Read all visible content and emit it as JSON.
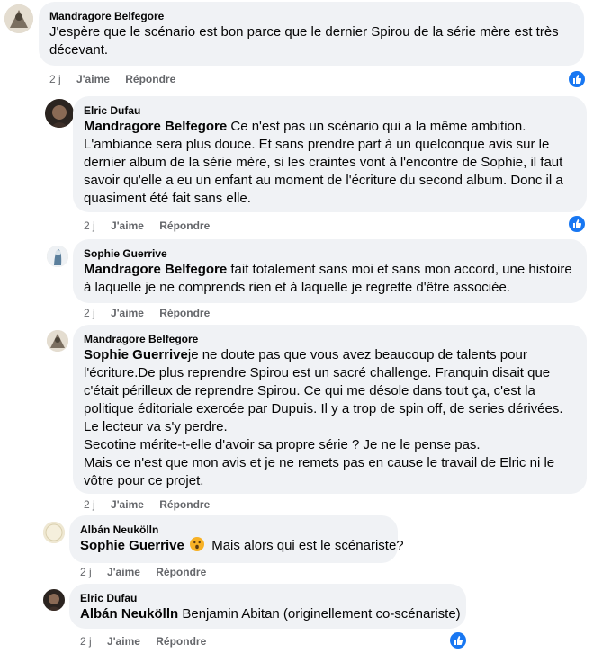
{
  "comments": [
    {
      "author": "Mandragore Belfegore",
      "lines": [
        "J'espère que le scénario est bon parce que le dernier Spirou de la série mère est très",
        "décevant."
      ],
      "time": "2 j",
      "like": "J'aime",
      "reply": "Répondre"
    },
    {
      "author": "Elric Dufau",
      "mention": "Mandragore Belfegore",
      "lines": [
        " Ce n'est pas un scénario qui a la même ambition.",
        "L'ambiance sera plus douce. Et sans prendre part à un quelconque avis sur le",
        "dernier album de la série mère, si les craintes vont à l'encontre de Sophie, il faut",
        "savoir qu'elle a eu un enfant au moment de l'écriture du second album. Donc il a",
        "quasiment été fait sans elle."
      ],
      "time": "2 j",
      "like": "J'aime",
      "reply": "Répondre"
    },
    {
      "author": "Sophie Guerrive",
      "mention": "Mandragore Belfegore",
      "lines": [
        " fait totalement sans moi et sans mon accord, une histoire",
        "à laquelle je ne comprends rien et à laquelle je regrette d'être associée."
      ],
      "time": "2 j",
      "like": "J'aime",
      "reply": "Répondre"
    },
    {
      "author": "Mandragore Belfegore",
      "mention": "Sophie Guerrive",
      "lines": [
        "je ne doute pas que vous avez beaucoup de talents pour",
        "l'écriture.De plus reprendre Spirou est un sacré challenge. Franquin disait que",
        "c'était périlleux de reprendre Spirou. Ce qui me désole dans tout ça, c'est la",
        "politique éditoriale exercée par Dupuis. Il y a trop de spin off, de series dérivées.",
        "Le lecteur va s'y perdre.",
        "Secotine mérite-t-elle d'avoir sa propre série ? Je ne le pense pas.",
        "Mais ce n'est que mon avis et je ne remets pas en cause le travail de Elric ni le",
        "vôtre pour ce projet."
      ],
      "time": "2 j",
      "like": "J'aime",
      "reply": "Répondre"
    },
    {
      "author": "Albán Neukölln",
      "mention": "Sophie Guerrive",
      "lines": [
        " Mais alors qui est le scénariste?"
      ],
      "time": "2 j",
      "like": "J'aime",
      "reply": "Répondre"
    },
    {
      "author": "Elric Dufau",
      "mention": "Albán Neukölln",
      "lines": [
        " Benjamin Abitan (originellement co-scénariste)"
      ],
      "time": "2 j",
      "like": "J'aime",
      "reply": "Répondre"
    }
  ],
  "colors": {
    "bubble": "#f0f2f5",
    "meta": "#65676b",
    "like_blue": "#1877f2"
  },
  "icons": {
    "reaction": "thumbs-up-icon",
    "emoji": "astonished-face-icon"
  }
}
